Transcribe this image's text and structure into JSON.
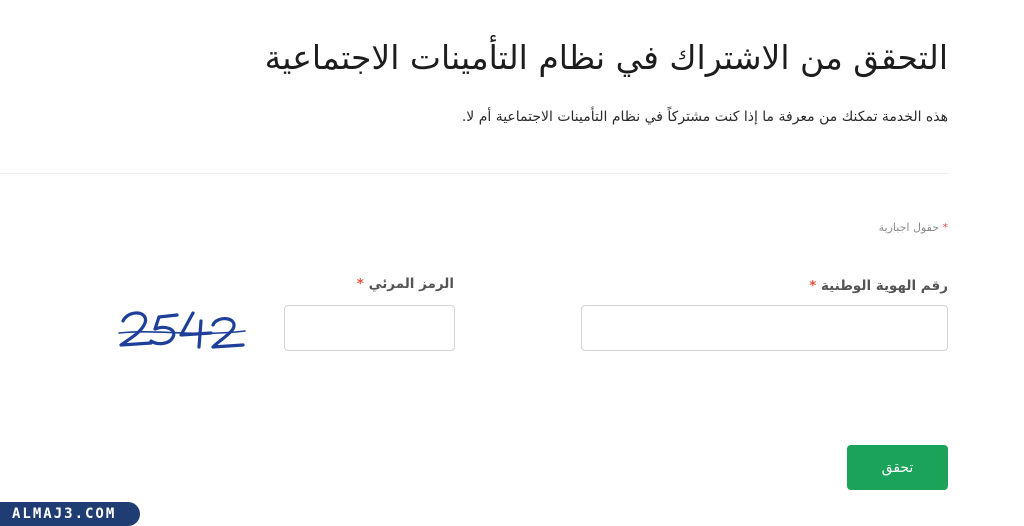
{
  "header": {
    "title": "التحقق من الاشتراك في نظام التأمينات الاجتماعية",
    "description": "هذه الخدمة تمكنك من معرفة ما إذا كنت مشتركاً في نظام التأمينات الاجتماعية أم لا."
  },
  "form": {
    "required_note": "حقول اجبارية",
    "required_marker": "*",
    "national_id": {
      "label": "رقم الهوية الوطنية",
      "value": "",
      "placeholder": ""
    },
    "captcha": {
      "label": "الرمز المرئي",
      "value": "",
      "placeholder": "",
      "image_text": "2542"
    },
    "submit_label": "تحقق"
  },
  "watermark": {
    "text": "ALMAJ3.COM"
  },
  "colors": {
    "accent": "#1ba35a",
    "required": "#e0533e",
    "captcha_ink": "#1e3f9a",
    "watermark_bg": "#1f3d73"
  }
}
